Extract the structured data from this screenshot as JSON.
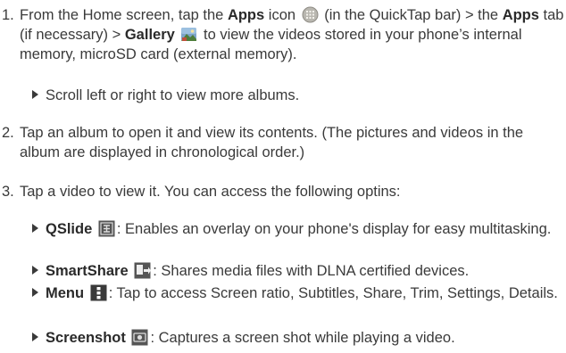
{
  "steps": [
    {
      "number": "1.",
      "t1": "From the Home screen, tap the ",
      "b1": "Apps",
      "t2": " icon ",
      "t3": " (in the QuickTap bar) > the ",
      "b2": "Apps",
      "t4": " tab (if necessary) > ",
      "b3": "Gallery",
      "t5": " ",
      "t6": " to view the videos stored in your phone’s internal memory, microSD card (external memory).",
      "icons": [
        "apps-icon",
        "gallery-icon"
      ]
    },
    {
      "number": "2.",
      "text": "Tap an album to open it and view its contents. (The pictures and videos in the album are displayed in chronological order.)"
    },
    {
      "number": "3.",
      "text": "Tap a video to view it. You can access the following optins:"
    }
  ],
  "sub_scroll": {
    "text": "Scroll left or right to view more albums."
  },
  "options": [
    {
      "label": "QSlide",
      "icon": "qslide-icon",
      "desc": ": Enables an overlay on your phone's display for easy multitasking."
    },
    {
      "label": "SmartShare",
      "icon": "smartshare-icon",
      "desc": ": Shares media files with DLNA certified devices."
    },
    {
      "label": "Menu",
      "icon": "menu-icon",
      "desc": ": Tap to access Screen ratio, Subtitles, Share, Trim, Settings, Details."
    },
    {
      "label": "Screenshot",
      "icon": "screenshot-icon",
      "desc": ": Captures a screen shot while playing a video."
    }
  ]
}
